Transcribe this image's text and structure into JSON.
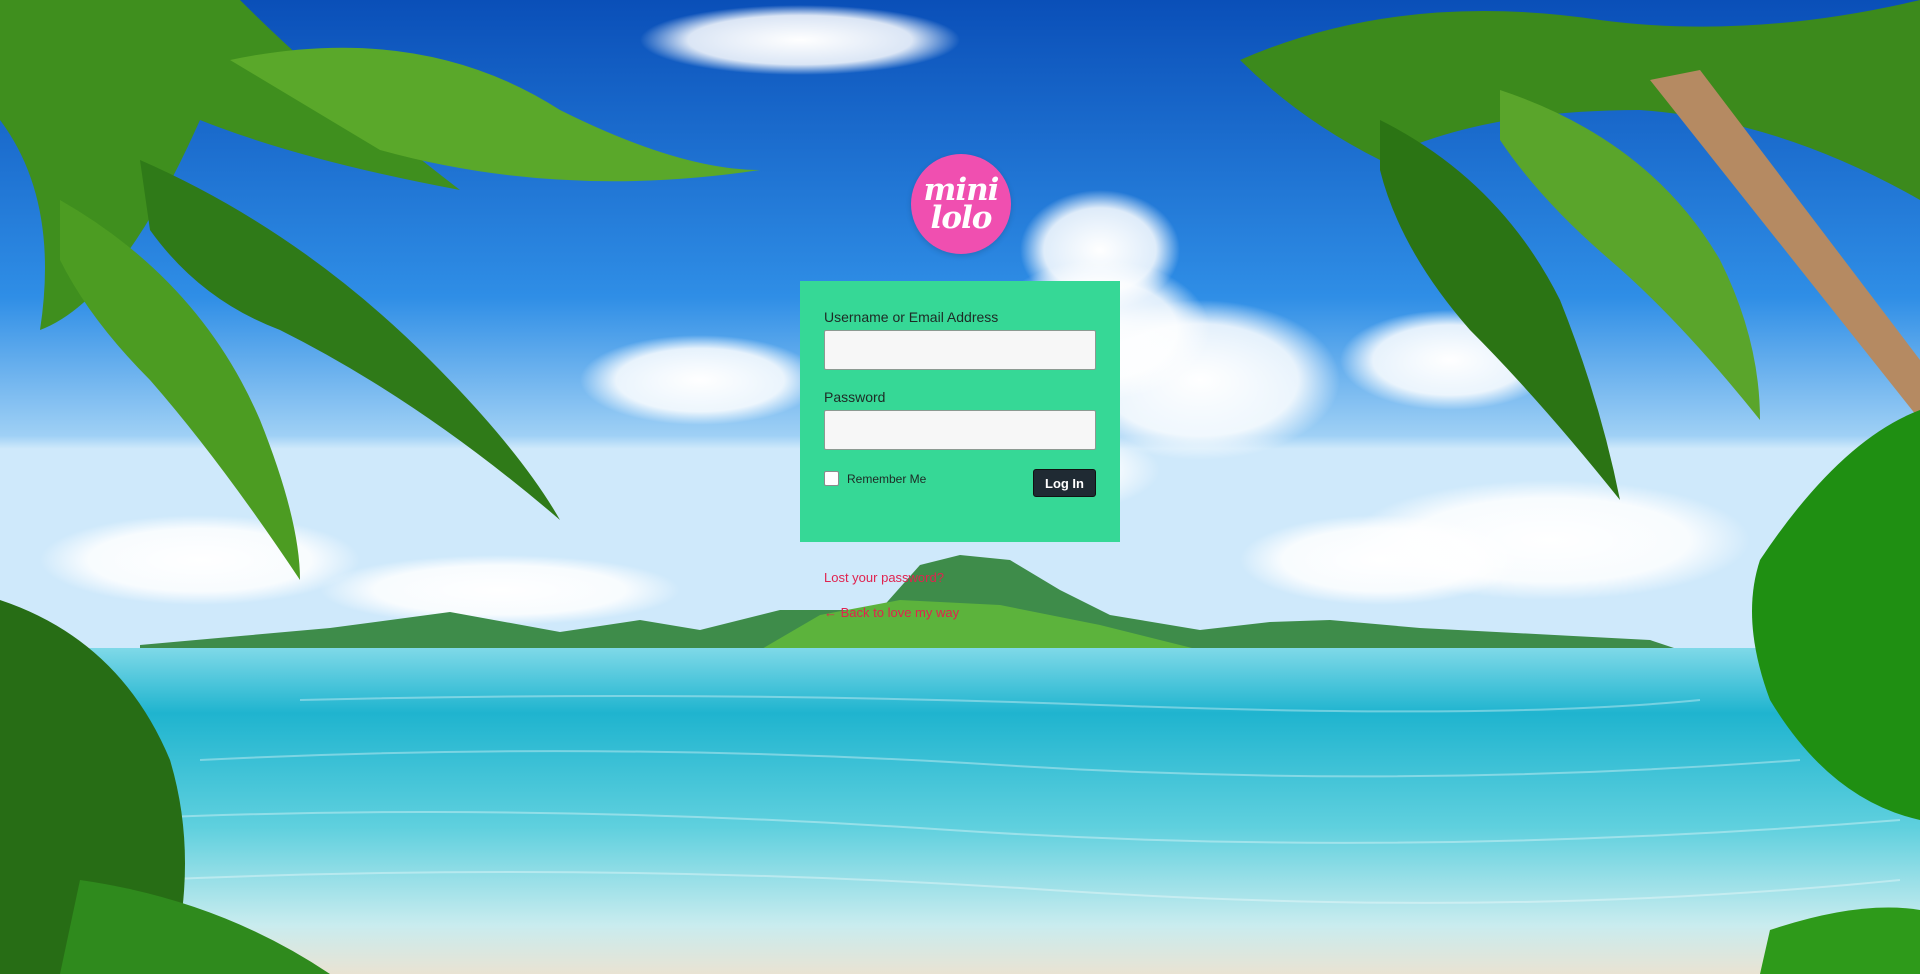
{
  "logo": {
    "line1": "mini",
    "line2": "lolo",
    "color": "#f04fb0"
  },
  "login_form": {
    "username_label": "Username or Email Address",
    "username_value": "",
    "password_label": "Password",
    "password_value": "",
    "remember_label": "Remember Me",
    "remember_checked": false,
    "submit_label": "Log In",
    "panel_color": "#36d896"
  },
  "links": {
    "lost_password": "Lost your password?",
    "back_to_site": "← Back to love my way",
    "color": "#e0234f"
  }
}
